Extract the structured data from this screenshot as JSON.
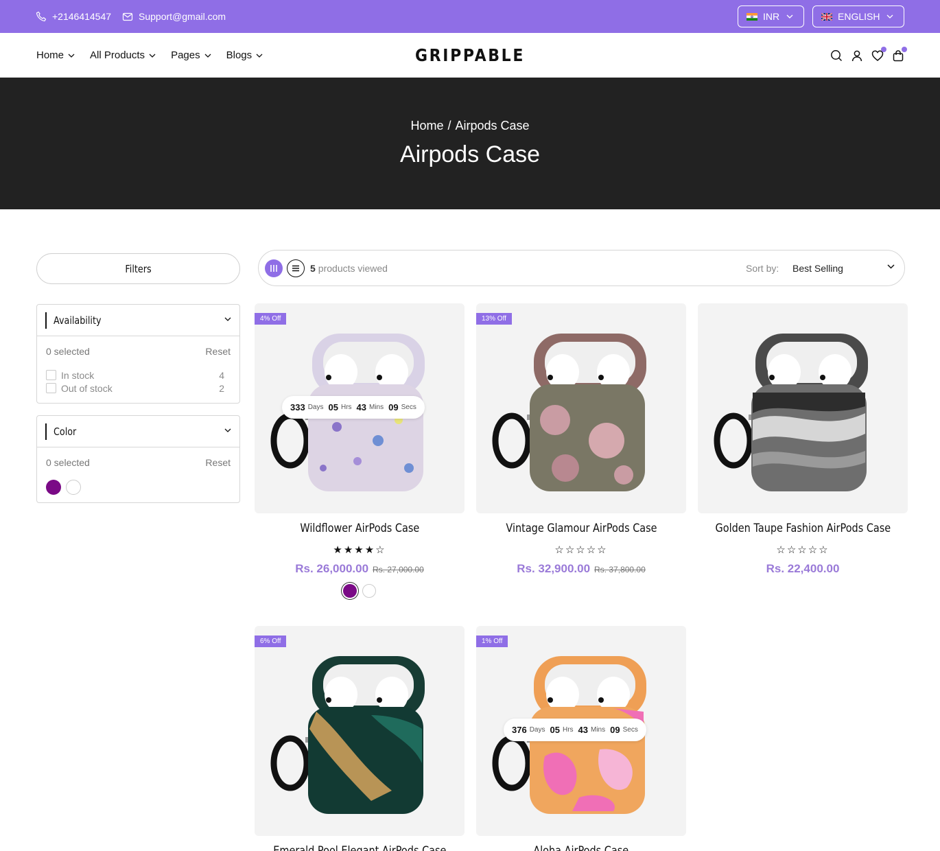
{
  "topbar": {
    "phone": "+2146414547",
    "email": "Support@gmail.com",
    "currency": "INR",
    "language": "ENGLISH"
  },
  "nav": {
    "items": [
      {
        "label": "Home"
      },
      {
        "label": "All Products"
      },
      {
        "label": "Pages"
      },
      {
        "label": "Blogs"
      }
    ]
  },
  "brand": {
    "logo": "GRIPPABLE"
  },
  "hero": {
    "breadcrumb_home": "Home",
    "breadcrumb_sep": "/",
    "breadcrumb_current": "Airpods Case",
    "title": "Airpods Case"
  },
  "sidebar": {
    "filters_label": "Filters",
    "availability": {
      "title": "Availability",
      "selected": "0 selected",
      "reset": "Reset",
      "options": [
        {
          "label": "In stock",
          "count": "4"
        },
        {
          "label": "Out of stock",
          "count": "2"
        }
      ]
    },
    "color": {
      "title": "Color",
      "selected": "0 selected",
      "reset": "Reset",
      "swatches": [
        "#7a0a86",
        "#ffffff"
      ]
    }
  },
  "toolbar": {
    "viewed_count": "5",
    "viewed_text": "products viewed",
    "sort_label": "Sort by:",
    "sort_value": "Best Selling"
  },
  "products": [
    {
      "name": "Wildflower AirPods Case",
      "badge": "4% Off",
      "rating": 4,
      "stars": "★★★★☆",
      "price": "Rs. 26,000.00",
      "compare": "Rs. 27,000.00",
      "timer": {
        "days": "333",
        "days_label": "Days",
        "hrs": "05",
        "hrs_label": "Hrs",
        "mins": "43",
        "mins_label": "Mins",
        "secs": "09",
        "secs_label": "Secs"
      },
      "swatches": [
        "#7a0a86",
        "#ffffff"
      ]
    },
    {
      "name": "Vintage Glamour AirPods Case",
      "badge": "13% Off",
      "rating": 0,
      "stars": "☆☆☆☆☆",
      "price": "Rs. 32,900.00",
      "compare": "Rs. 37,800.00"
    },
    {
      "name": "Golden Taupe Fashion AirPods Case",
      "rating": 0,
      "stars": "☆☆☆☆☆",
      "price": "Rs. 22,400.00"
    },
    {
      "name": "Emerald Pool Elegant AirPods Case",
      "badge": "6% Off"
    },
    {
      "name": "Aloha AirPods Case",
      "badge": "1% Off",
      "timer": {
        "days": "376",
        "days_label": "Days",
        "hrs": "05",
        "hrs_label": "Hrs",
        "mins": "43",
        "mins_label": "Mins",
        "secs": "09",
        "secs_label": "Secs"
      }
    }
  ],
  "colors": {
    "accent": "#8f6ee6",
    "hero_bg": "#222222",
    "price": "#9a7ad8"
  }
}
